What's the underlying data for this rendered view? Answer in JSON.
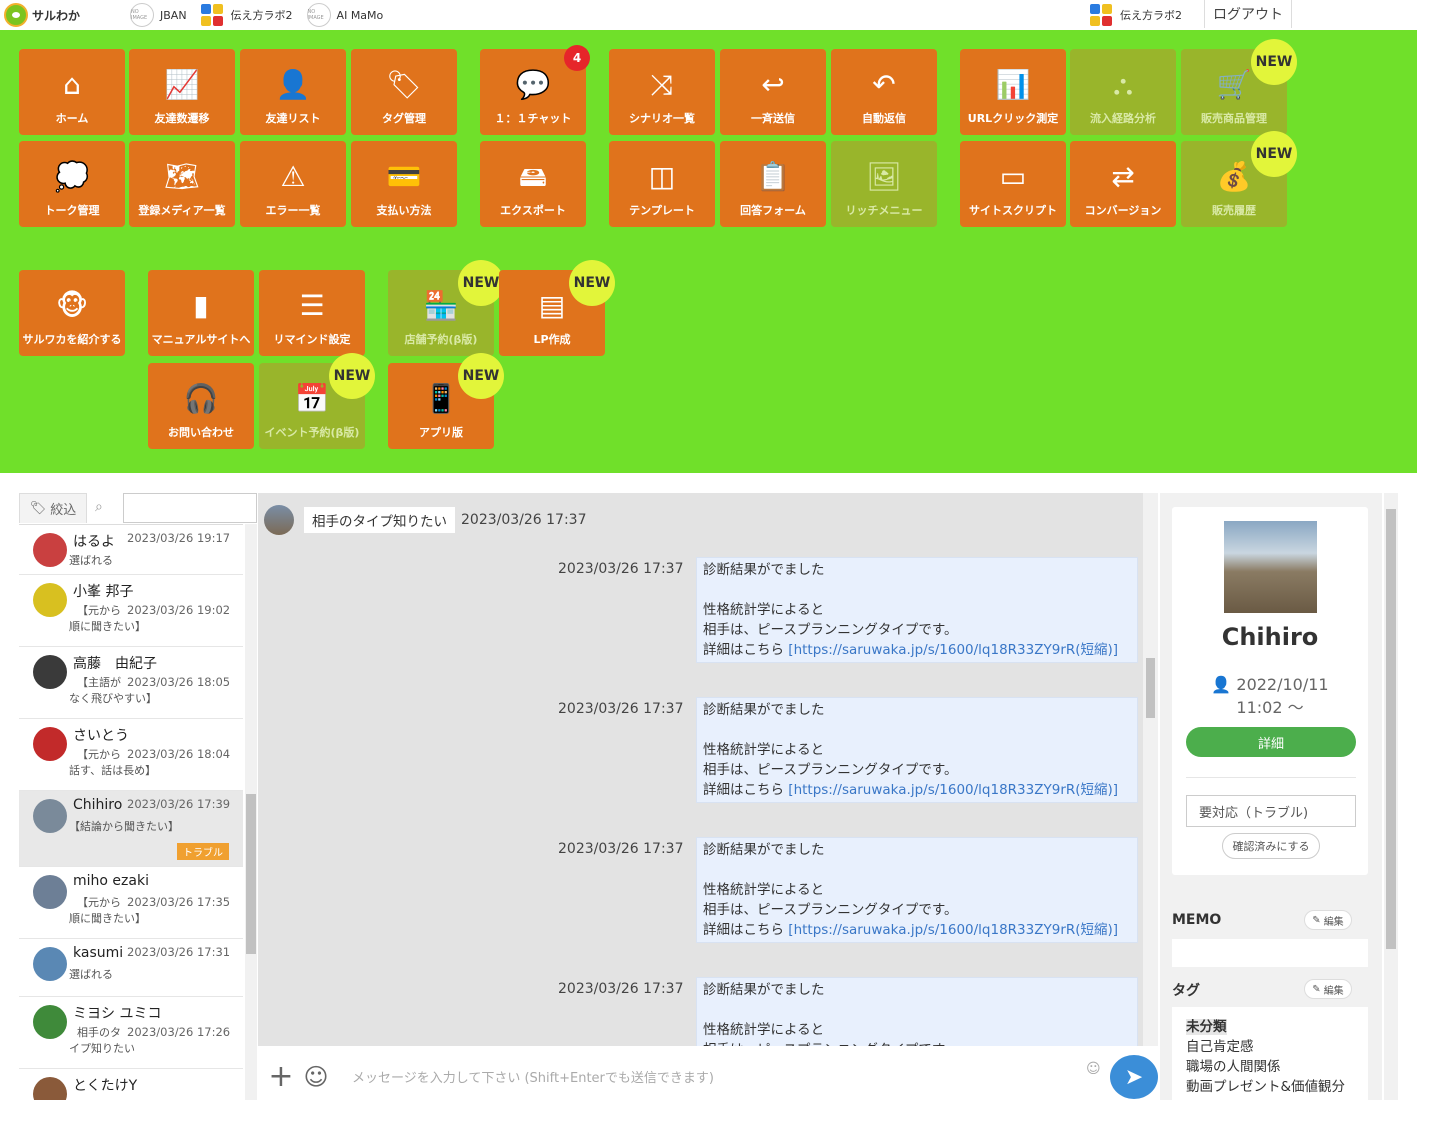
{
  "header": {
    "logo_text": "サルわか",
    "accounts": [
      {
        "name": "JBAN",
        "avatar": "NO IMAGE"
      },
      {
        "name": "伝え方ラボ2",
        "avatar": "squares"
      },
      {
        "name": "AI MaMo",
        "avatar": "NO IMAGE"
      }
    ],
    "current_account": "伝え方ラボ2",
    "logout": "ログアウト"
  },
  "menu": {
    "tiles": [
      {
        "label": "ホーム",
        "icon": "home-icon",
        "glyph": "⌂"
      },
      {
        "label": "友達数遷移",
        "icon": "chart-icon",
        "glyph": "📈"
      },
      {
        "label": "友達リスト",
        "icon": "user-icon",
        "glyph": "👤"
      },
      {
        "label": "タグ管理",
        "icon": "tag-icon",
        "glyph": "🏷"
      },
      {
        "label": "１：１チャット",
        "icon": "chat-icon",
        "glyph": "💬",
        "count": "4"
      },
      {
        "label": "シナリオ一覧",
        "icon": "shuffle-icon",
        "glyph": "⤨"
      },
      {
        "label": "一斉送信",
        "icon": "reply-icon",
        "glyph": "↩"
      },
      {
        "label": "自動返信",
        "icon": "undo-icon",
        "glyph": "↶"
      },
      {
        "label": "URLクリック測定",
        "icon": "analytics-icon",
        "glyph": "📊"
      },
      {
        "label": "流入経路分析",
        "icon": "sitemap-icon",
        "glyph": "⛬"
      },
      {
        "label": "販売商品管理",
        "icon": "cart-icon",
        "glyph": "🛒",
        "new": "NEW"
      },
      {
        "label": "トーク管理",
        "icon": "speech-icon",
        "glyph": "💭"
      },
      {
        "label": "登録メディア一覧",
        "icon": "map-icon",
        "glyph": "🗺"
      },
      {
        "label": "エラー一覧",
        "icon": "warning-icon",
        "glyph": "⚠"
      },
      {
        "label": "支払い方法",
        "icon": "card-icon",
        "glyph": "💳"
      },
      {
        "label": "エクスポート",
        "icon": "drive-icon",
        "glyph": "🖴"
      },
      {
        "label": "テンプレート",
        "icon": "columns-icon",
        "glyph": "◫"
      },
      {
        "label": "回答フォーム",
        "icon": "clipboard-icon",
        "glyph": "📋"
      },
      {
        "label": "リッチメニュー",
        "icon": "image-icon",
        "glyph": "🖼"
      },
      {
        "label": "サイトスクリプト",
        "icon": "browser-icon",
        "glyph": "▭"
      },
      {
        "label": "コンバージョン",
        "icon": "exchange-icon",
        "glyph": "⇄"
      },
      {
        "label": "販売履歴",
        "icon": "moneybag-icon",
        "glyph": "💰",
        "new": "NEW"
      },
      {
        "label": "サルワカを紹介する",
        "icon": "monkey-icon",
        "glyph": "🐵"
      },
      {
        "label": "マニュアルサイトへ",
        "icon": "book-icon",
        "glyph": "▮"
      },
      {
        "label": "リマインド設定",
        "icon": "list-icon",
        "glyph": "☰"
      },
      {
        "label": "店舗予約(β版)",
        "icon": "store-icon",
        "glyph": "🏪",
        "new": "NEW"
      },
      {
        "label": "LP作成",
        "icon": "layout-icon",
        "glyph": "▤",
        "new": "NEW"
      },
      {
        "label": "お問い合わせ",
        "icon": "headset-icon",
        "glyph": "🎧"
      },
      {
        "label": "イベント予約(β版)",
        "icon": "calendar-icon",
        "glyph": "📅",
        "new": "NEW"
      },
      {
        "label": "アプリ版",
        "icon": "phone-icon",
        "glyph": "📱",
        "new": "NEW"
      }
    ]
  },
  "sidebar": {
    "filter_label": "絞込",
    "items": [
      {
        "name": "はるよ",
        "time": "2023/03/26 19:17",
        "preview": [
          "選ばれる"
        ],
        "avatar": "#c94040"
      },
      {
        "name": "小峯 邦子",
        "time": "2023/03/26 19:02",
        "preview": [
          "【元から",
          "順に聞きたい】"
        ],
        "avatar": "#d8c020"
      },
      {
        "name": "高藤　由紀子",
        "time": "2023/03/26 18:05",
        "preview": [
          "【主語が",
          "なく飛びやすい】"
        ],
        "avatar": "#3a3a3a"
      },
      {
        "name": "さいとう",
        "time": "2023/03/26 18:04",
        "preview": [
          "【元から",
          "話す、話は長め】"
        ],
        "avatar": "#c22a2a"
      },
      {
        "name": "Chihiro",
        "time": "2023/03/26 17:39",
        "preview": [
          "【結論から聞きたい】"
        ],
        "tag": "トラブル",
        "avatar": "#7a8a9a"
      },
      {
        "name": "miho ezaki",
        "time": "2023/03/26 17:35",
        "preview": [
          "【元から",
          "順に聞きたい】"
        ],
        "avatar": "#6d7f96"
      },
      {
        "name": "kasumi",
        "time": "2023/03/26 17:31",
        "preview": [
          "選ばれる"
        ],
        "avatar": "#5a88b4"
      },
      {
        "name": "ミヨシ ユミコ",
        "time": "2023/03/26 17:26",
        "preview": [
          "相手のタ",
          "イプ知りたい"
        ],
        "avatar": "#3f8a3a"
      },
      {
        "name": "とくたけY",
        "time": "",
        "preview": [],
        "avatar": "#8a5a3a"
      }
    ]
  },
  "chat": {
    "incoming": {
      "text": "相手のタイプ知りたい",
      "time": "2023/03/26 17:37"
    },
    "outgoing": [
      {
        "time": "2023/03/26 17:37",
        "line1": "診断結果がでました",
        "line2": "性格統計学によると",
        "line3": "相手は、ピースプランニングタイプです。",
        "line4": "詳細はこちら ",
        "link": "[https://saruwaka.jp/s/1600/lq18R33ZY9rR(短縮)]"
      },
      {
        "time": "2023/03/26 17:37",
        "line1": "診断結果がでました",
        "line2": "性格統計学によると",
        "line3": "相手は、ピースプランニングタイプです。",
        "line4": "詳細はこちら ",
        "link": "[https://saruwaka.jp/s/1600/lq18R33ZY9rR(短縮)]"
      },
      {
        "time": "2023/03/26 17:37",
        "line1": "診断結果がでました",
        "line2": "性格統計学によると",
        "line3": "相手は、ピースプランニングタイプです。",
        "line4": "詳細はこちら ",
        "link": "[https://saruwaka.jp/s/1600/lq18R33ZY9rR(短縮)]"
      },
      {
        "time": "2023/03/26 17:37",
        "line1": "診断結果がでました",
        "line2": "性格統計学によると",
        "line3": "相手は、ピースプランニングタイプです。",
        "line4": "",
        "link": ""
      }
    ],
    "composer_placeholder": "メッセージを入力して下さい (Shift+Enterでも送信できます)"
  },
  "profile": {
    "name": "Chihiro",
    "date": "2022/10/11",
    "time": "11:02 〜",
    "detail_button": "詳細",
    "status": "要対応（トラブル)",
    "confirm_button": "確認済みにする",
    "memo_title": "MEMO",
    "tag_title": "タグ",
    "edit_label": "編集",
    "tags": [
      "未分類",
      "自己肯定感",
      "職場の人間関係",
      "動画プレゼント&価値観分"
    ]
  },
  "colors": {
    "tile": "#e0731c",
    "tile_dim": "#99b52b",
    "menu_bg": "#70e02a",
    "new_badge": "#e2f53a",
    "send": "#3b8ed8"
  }
}
